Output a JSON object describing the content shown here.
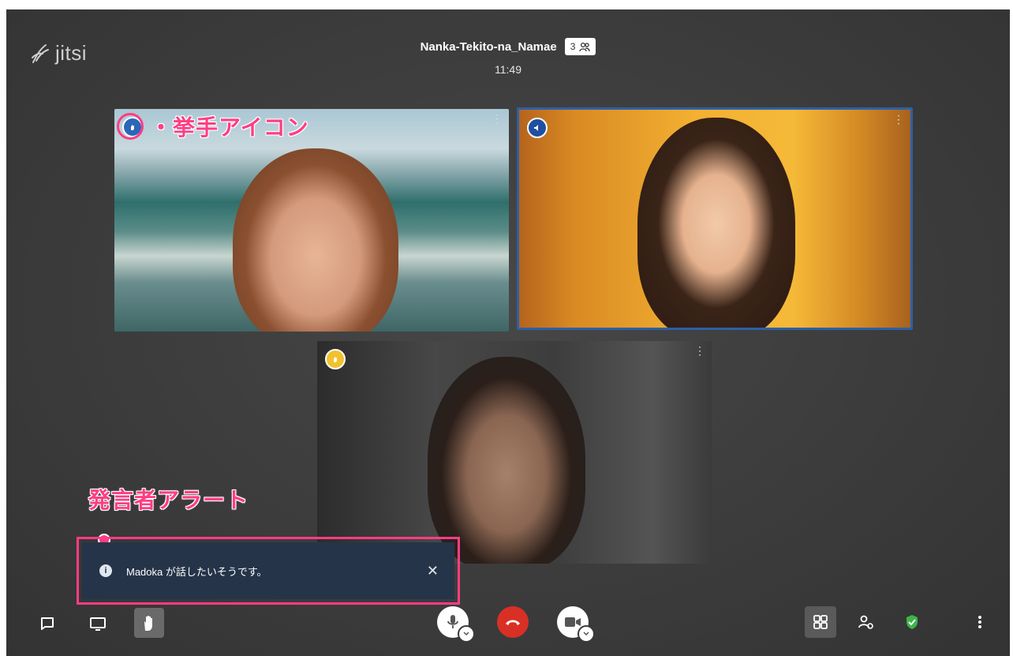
{
  "app": {
    "logo_text": "jitsi"
  },
  "meeting": {
    "title": "Nanka-Tekito-na_Namae",
    "participant_count": "3",
    "timer": "11:49"
  },
  "annotations": {
    "raise_hand_label": "・挙手アイコン",
    "speaker_alert_label": "発言者アラート"
  },
  "notification": {
    "message": "Madoka が話したいそうです。",
    "close_symbol": "✕"
  },
  "colors": {
    "accent_pink": "#ff3d83",
    "active_border": "#2e5fa6",
    "hangup_red": "#d93025",
    "notify_bg": "#253449",
    "security_green": "#3cb54a"
  },
  "toolbar": {
    "left": [
      "chat-icon",
      "screenshare-icon",
      "raise-hand-icon"
    ],
    "center": [
      "microphone-icon",
      "hangup-icon",
      "camera-icon"
    ],
    "right": [
      "tile-view-icon",
      "invite-icon",
      "security-shield-icon",
      "more-options-icon"
    ]
  }
}
